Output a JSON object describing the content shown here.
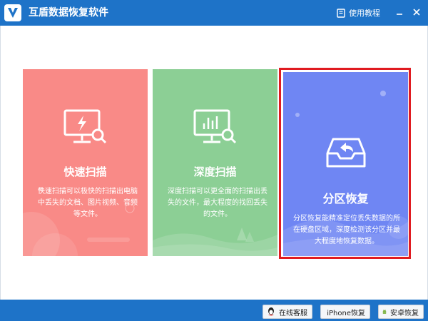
{
  "app": {
    "title": "互盾数据恢复软件"
  },
  "header": {
    "tutorial_label": "使用教程"
  },
  "cards": [
    {
      "id": "quick",
      "title": "快速扫描",
      "description": "快速扫描可以极快的扫描出电脑中丢失的文档、图片视频、音频等文件。",
      "icon": "monitor-lightning-icon"
    },
    {
      "id": "deep",
      "title": "深度扫描",
      "description": "深度扫描可以更全面的扫描出丢失的文件，最大程度的找回丢失的文件。",
      "icon": "monitor-chart-icon"
    },
    {
      "id": "partition",
      "title": "分区恢复",
      "description": "分区恢复能精准定位丢失数据的所在硬盘区域，深度检测该分区并最大程度地恢复数据。",
      "icon": "tray-return-icon"
    }
  ],
  "footer": {
    "qq_label": "在线客服",
    "iphone_label": "iPhone恢复",
    "android_label": "安卓恢复"
  },
  "colors": {
    "titlebar": "#1e73c8",
    "quick": "#f98a87",
    "deep": "#8ccf95",
    "partition": "#6f86f3",
    "selection": "#e01b21"
  }
}
